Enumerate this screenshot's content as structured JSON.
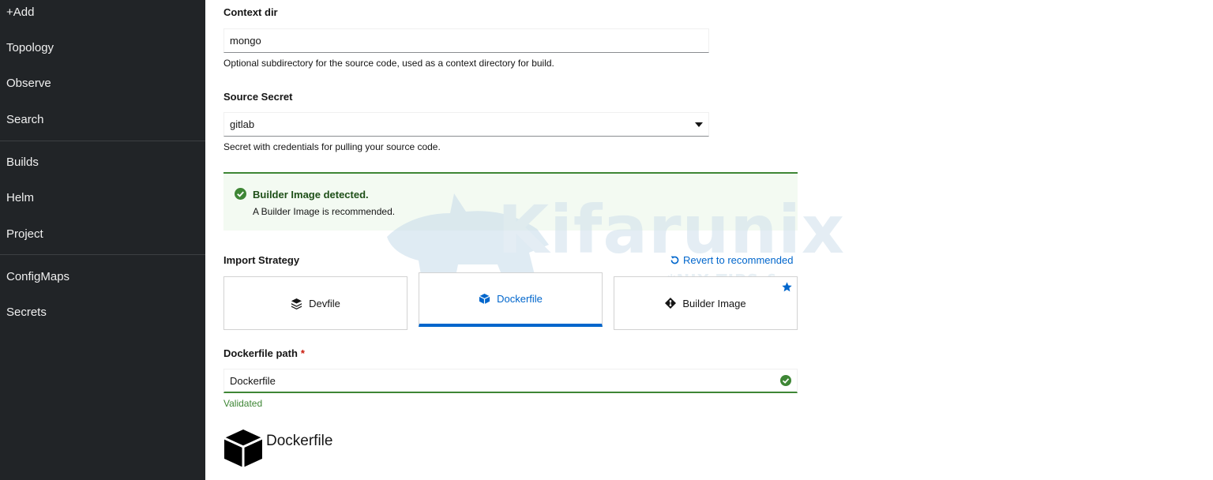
{
  "sidebar": {
    "items": [
      {
        "label": "+Add"
      },
      {
        "label": "Topology"
      },
      {
        "label": "Observe"
      },
      {
        "label": "Search"
      },
      {
        "label": "Builds"
      },
      {
        "label": "Helm"
      },
      {
        "label": "Project"
      },
      {
        "label": "ConfigMaps"
      },
      {
        "label": "Secrets"
      }
    ]
  },
  "form": {
    "context_dir": {
      "label": "Context dir",
      "value": "mongo",
      "helper": "Optional subdirectory for the source code, used as a context directory for build."
    },
    "source_secret": {
      "label": "Source Secret",
      "value": "gitlab",
      "helper": "Secret with credentials for pulling your source code."
    },
    "alert": {
      "title": "Builder Image detected.",
      "description": "A Builder Image is recommended."
    },
    "import_strategy": {
      "label": "Import Strategy",
      "revert_label": "Revert to recommended",
      "options": [
        {
          "label": "Devfile"
        },
        {
          "label": "Dockerfile",
          "selected": true
        },
        {
          "label": "Builder Image",
          "recommended": true
        }
      ]
    },
    "dockerfile_path": {
      "label": "Dockerfile path",
      "required_mark": "*",
      "value": "Dockerfile",
      "status": "Validated"
    },
    "dockerfile_logo": {
      "label": "Dockerfile"
    }
  },
  "watermark": {
    "brand": "Kifarunix",
    "tagline": "*NIX TIPS & TUTORIALS"
  },
  "colors": {
    "sidebar_bg": "#212427",
    "accent": "#0066cc",
    "success": "#3e8635"
  }
}
